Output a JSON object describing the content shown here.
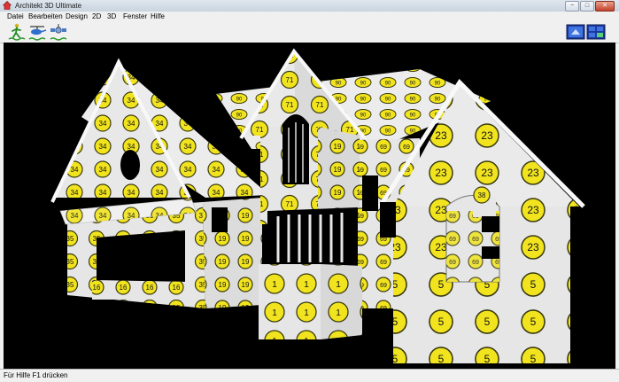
{
  "window": {
    "title": "Architekt 3D Ultimate"
  },
  "menu": {
    "items": [
      "Datei",
      "Bearbeiten",
      "Design",
      "2D",
      "3D",
      "Fenster",
      "Hilfe"
    ]
  },
  "toolbar": {
    "left_tools": [
      "walking-person-icon",
      "helicopter-icon",
      "satellite-icon"
    ],
    "right_tools": [
      "single-view-icon",
      "split-view-icon"
    ]
  },
  "window_buttons": {
    "minimize": "−",
    "maximize": "□",
    "close": "✕"
  },
  "scene": {
    "texture_labels": {
      "left_house": "34",
      "left_house_lower": "35",
      "left_house_mid": "39",
      "left_base": "16",
      "left_side": "33",
      "left_row": "19",
      "tower_top": "71",
      "tower_base": "1",
      "back_roof": "90",
      "back_wall": "69",
      "right_house": "23",
      "right_house_lower": "5",
      "right_house_arch": "38"
    },
    "colors": {
      "wall": "#e6e6e6",
      "roof": "#f2f2f2",
      "label_fill": "#f1e41f",
      "label_stroke": "#3a3a10",
      "background": "#000000"
    }
  },
  "status": {
    "text": "Für Hilfe F1 drücken"
  }
}
